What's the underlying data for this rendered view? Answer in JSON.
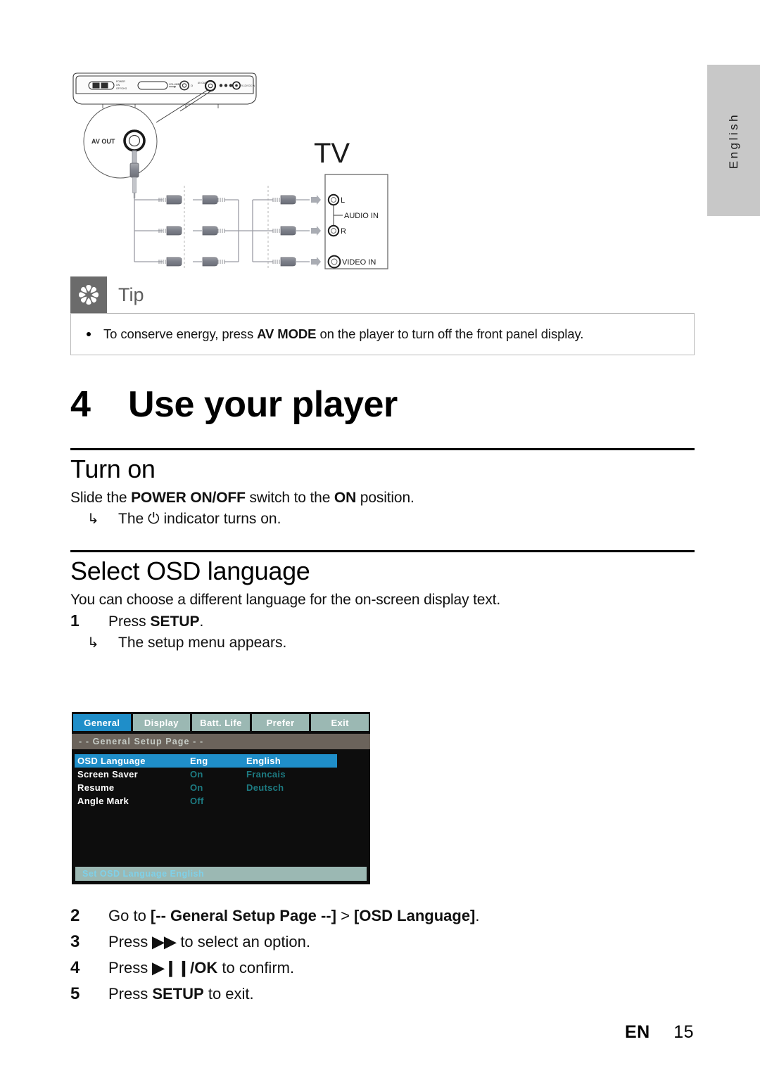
{
  "page": {
    "language_tab": "English",
    "footer_locale": "EN",
    "footer_page": "15"
  },
  "diagram": {
    "device_labels": {
      "power": "POWER",
      "power_on": "ON",
      "power_off": "OFF/CHG",
      "volume": "VOLUME",
      "headphone": "Ω",
      "av_out": "AV OUT",
      "dc_in": "9-12V DC IN"
    },
    "callout_label": "AV OUT",
    "tv_label": "TV",
    "tv_jacks": [
      {
        "name": "L"
      },
      {
        "name": "R"
      },
      {
        "name": "VIDEO IN"
      }
    ],
    "audio_in_label": "AUDIO IN",
    "video_in_label": "VIDEO IN"
  },
  "tip": {
    "icon": "asterisk-icon",
    "label": "Tip",
    "text_before": "To conserve energy, press ",
    "text_bold": "AV MODE",
    "text_after": " on the player to turn off the front panel display."
  },
  "chapter": {
    "number": "4",
    "title": "Use your player"
  },
  "turn_on": {
    "heading": "Turn on",
    "line_before": "Slide the ",
    "line_bold1": "POWER ON/OFF",
    "line_mid": " switch to the ",
    "line_bold2": "ON",
    "line_after": " position.",
    "result_arrow": "↳",
    "result_before": "The ",
    "result_symbol": "⏻",
    "result_after": " indicator turns on."
  },
  "osd_language": {
    "heading": "Select OSD language",
    "intro": "You can choose a different language for the on-screen display text.",
    "step1": {
      "num": "1",
      "text_before": "Press ",
      "text_bold": "SETUP",
      "text_after": "."
    },
    "step1_result_arrow": "↳",
    "step1_result": "The setup menu appears.",
    "steps": [
      {
        "num": "2",
        "before": "Go to ",
        "bold1": "[-- General Setup Page --]",
        "mid": " > ",
        "bold2": "[OSD Language]",
        "after": "."
      },
      {
        "num": "3",
        "before": "Press ",
        "bold1": "▶▶",
        "mid": "",
        "bold2": "",
        "after": " to select an option."
      },
      {
        "num": "4",
        "before": "Press ",
        "bold1": "▶❙❙",
        "mid": "",
        "bold2": "/OK",
        "after": " to confirm."
      },
      {
        "num": "5",
        "before": "Press ",
        "bold1": "SETUP",
        "mid": "",
        "bold2": "",
        "after": " to exit."
      }
    ]
  },
  "osd_screen": {
    "tabs": [
      {
        "label": "General",
        "active": true
      },
      {
        "label": "Display",
        "active": false
      },
      {
        "label": "Batt. Life",
        "active": false
      },
      {
        "label": "Prefer",
        "active": false
      },
      {
        "label": "Exit",
        "active": false
      }
    ],
    "page_header": "- -   General Setup Page   - -",
    "rows": [
      {
        "label": "OSD  Language",
        "value": "Eng",
        "option": "English",
        "selected": true
      },
      {
        "label": "Screen Saver",
        "value": "On",
        "option": "Francais",
        "selected": false
      },
      {
        "label": "Resume",
        "value": "On",
        "option": "Deutsch",
        "selected": false
      },
      {
        "label": "Angle Mark",
        "value": "Off",
        "option": "",
        "selected": false
      }
    ],
    "status_bar": "Set OSD Language English",
    "colors": {
      "highlight": "#1f8ec9",
      "tab_inactive": "#9bb8b3",
      "page_header_bg": "#6b635b",
      "value_text": "#1d7b82",
      "status_text": "#7fd0e8",
      "background": "#0d0d0d"
    }
  }
}
